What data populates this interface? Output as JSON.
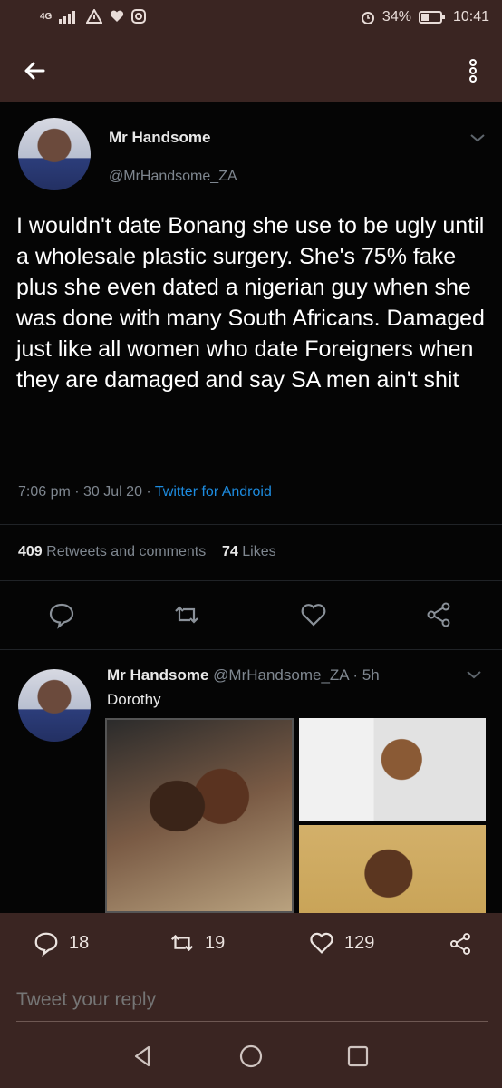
{
  "status_bar": {
    "network": "4G",
    "battery": "34%",
    "time": "10:41"
  },
  "tweet": {
    "author_name": "Mr Handsome",
    "author_handle": "@MrHandsome_ZA",
    "text": "I wouldn't date Bonang she use to be ugly until a wholesale plastic surgery. She's 75% fake plus she even dated a nigerian guy when she was done with many South Africans. Damaged just like all women who date Foreigners when they are damaged and say SA men ain't shit",
    "time": "7:06 pm",
    "date": "30 Jul 20",
    "source": "Twitter for Android",
    "retweets_count": "409",
    "retweets_label": "Retweets and comments",
    "likes_count": "74",
    "likes_label": "Likes"
  },
  "reply": {
    "author_name": "Mr Handsome",
    "author_handle": "@MrHandsome_ZA",
    "age": "· 5h",
    "text": "Dorothy"
  },
  "overlay_actions": {
    "replies": "18",
    "retweets": "19",
    "likes": "129"
  },
  "reply_bar": {
    "placeholder": "Tweet your reply"
  },
  "icons": {
    "back": "back-arrow-icon",
    "menu": "more-vertical-icon",
    "reply": "comment-icon",
    "retweet": "retweet-icon",
    "like": "heart-icon",
    "share": "share-icon"
  },
  "colors": {
    "frame": "#3a2522",
    "tweet_bg": "#050505",
    "link": "#1d8ce0",
    "muted": "#7f8790"
  }
}
